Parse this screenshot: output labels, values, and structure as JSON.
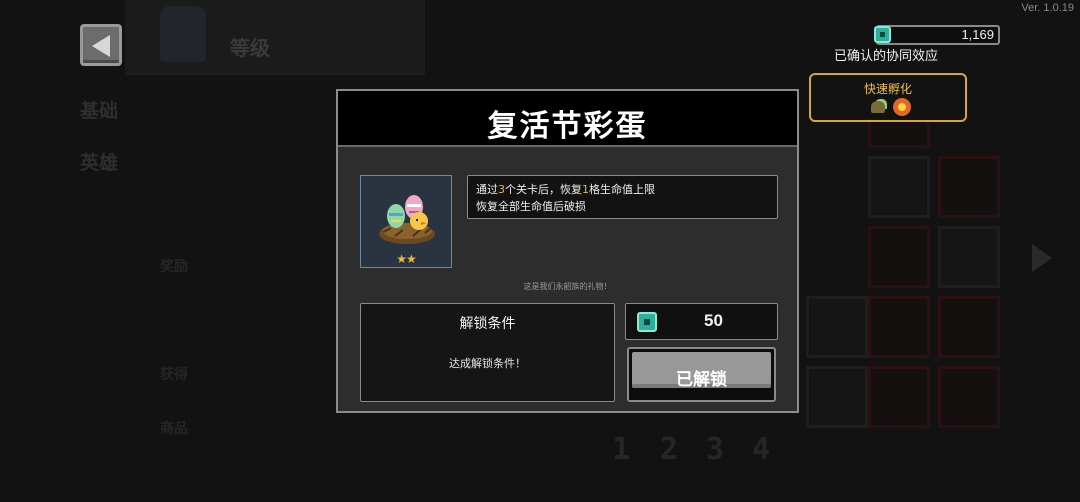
{
  "app": {
    "version": "Ver. 1.0.19"
  },
  "background": {
    "title": "等级",
    "side_labels": [
      "基础",
      "英雄"
    ],
    "small_labels": [
      "奖励",
      "获得",
      "商品"
    ],
    "page_numbers": [
      "1",
      "2",
      "3",
      "4"
    ]
  },
  "currency": {
    "gems": "1,169",
    "icon": "gem-icon"
  },
  "synergy": {
    "title": "已确认的协同效应",
    "active_label": "快速孵化"
  },
  "modal": {
    "title": "复活节彩蛋",
    "item_icon": "easter-egg-nest-icon",
    "rarity_stars": "★★",
    "description": {
      "line1_parts": [
        "通过",
        "3",
        "个关卡后，恢复",
        "1",
        "格生命值上限"
      ],
      "line2": "恢复全部生命值后破损"
    },
    "flavor_text": "这是我们永韶族的礼物！",
    "unlock": {
      "heading": "解锁条件",
      "condition": "达成解锁条件！"
    },
    "cost": {
      "value": "50",
      "icon": "gem-icon"
    },
    "status_button": "已解锁",
    "colors": {
      "highlight": "#f2b83a",
      "accent_gem": "#2fae9a"
    }
  }
}
